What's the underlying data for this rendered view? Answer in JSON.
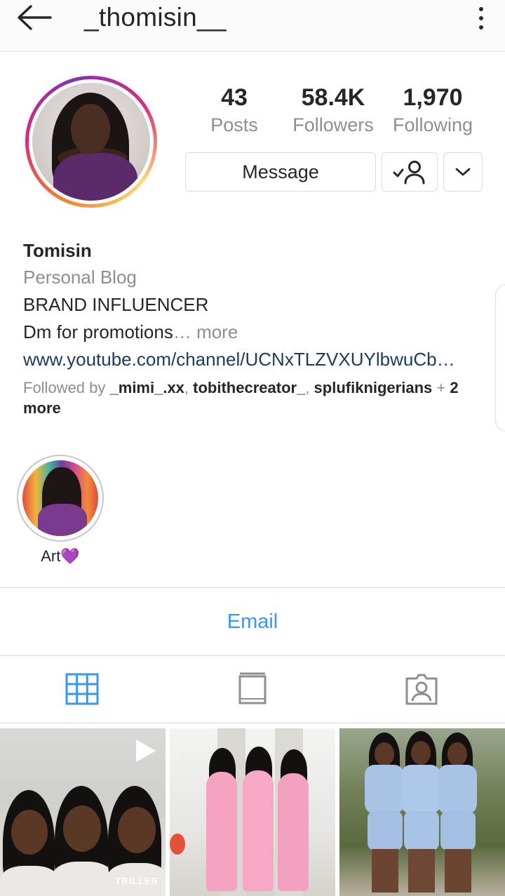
{
  "header": {
    "username": "_thomisin__",
    "back_icon": "arrow-left-icon",
    "menu_icon": "more-vertical-icon"
  },
  "profile": {
    "avatar_description": "profile-photo",
    "stats": {
      "posts_count": "43",
      "posts_label": "Posts",
      "followers_count": "58.4K",
      "followers_label": "Followers",
      "following_count": "1,970",
      "following_label": "Following"
    },
    "actions": {
      "message_label": "Message",
      "following_icon": "user-check-icon",
      "more_icon": "chevron-down-icon"
    }
  },
  "bio": {
    "name": "Tomisin",
    "category": "Personal Blog",
    "line1": "BRAND INFLUENCER",
    "line2": "Dm for promotions",
    "more_label": "… more",
    "link": "www.youtube.com/channel/UCNxTLZVXUYlbwuCb…",
    "followed_by_prefix": "Followed by ",
    "followed_by_user1": "_mimi_.xx",
    "separator1": ", ",
    "followed_by_user2": "tobithecreator_",
    "separator2": ", ",
    "followed_by_user3": "splufiknigerians",
    "plus": " + ",
    "more_count": "2 more"
  },
  "highlights": [
    {
      "label": "Art💜"
    }
  ],
  "contact": {
    "email_label": "Email"
  },
  "tabs": {
    "grid_icon": "grid-icon",
    "igtv_icon": "igtv-icon",
    "tagged_icon": "tagged-user-icon",
    "active": "grid"
  },
  "posts": [
    {
      "type": "video",
      "watermark": "TRILLER"
    },
    {
      "type": "photo"
    },
    {
      "type": "photo"
    }
  ],
  "colors": {
    "link_blue": "#3897f0",
    "text": "#262626",
    "muted": "#8e8e8e",
    "border": "#dbdbdb"
  }
}
